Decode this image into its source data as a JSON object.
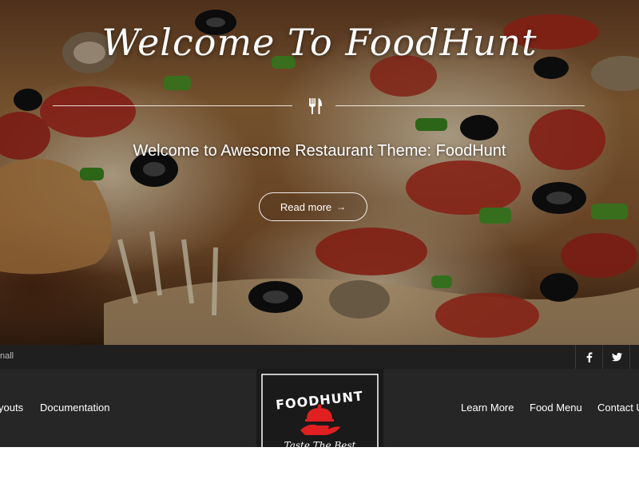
{
  "hero": {
    "title": "Welcome To FoodHunt",
    "subtitle": "Welcome to Awesome Restaurant Theme: FoodHunt",
    "button_label": "Read more",
    "button_arrow": "→"
  },
  "topbar": {
    "text": "nall"
  },
  "social": [
    {
      "icon": "facebook-icon"
    },
    {
      "icon": "twitter-icon"
    },
    {
      "icon": "google-plus-icon"
    }
  ],
  "nav": {
    "left": [
      "youts",
      "Documentation"
    ],
    "right": [
      "Learn More",
      "Food Menu",
      "Contact U"
    ]
  },
  "logo": {
    "name": "FOODHUNT",
    "tagline": "Taste The Best",
    "icon": "serving-hand-icon"
  },
  "colors": {
    "topbar_bg": "#1f1f1f",
    "nav_bg": "#262626",
    "logo_bg": "#1a1a1a",
    "logo_accent": "#e02020",
    "text": "#ffffff"
  }
}
